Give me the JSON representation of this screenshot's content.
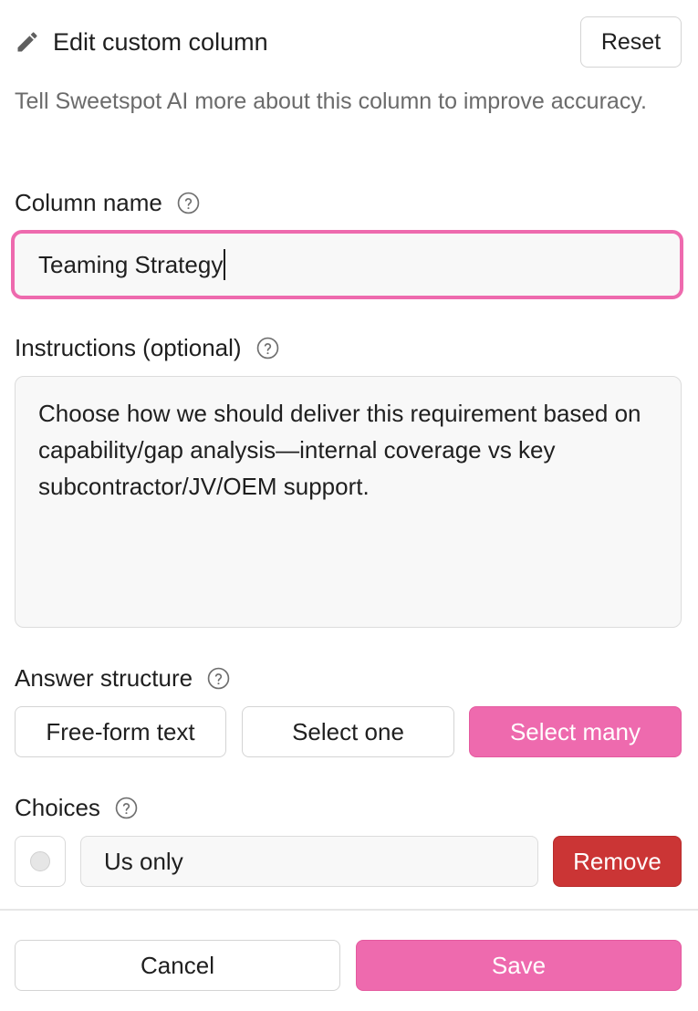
{
  "header": {
    "title": "Edit custom column",
    "reset_label": "Reset",
    "icon": "pencil-icon"
  },
  "subtitle": "Tell Sweetspot AI more about this column to improve accuracy.",
  "column_name": {
    "label": "Column name",
    "value": "Teaming Strategy"
  },
  "instructions": {
    "label": "Instructions (optional)",
    "value": "Choose how we should deliver this requirement based on capability/gap analysis—internal coverage vs key subcontractor/JV/OEM support."
  },
  "answer_structure": {
    "label": "Answer structure",
    "options": [
      "Free-form text",
      "Select one",
      "Select many"
    ],
    "selected": "Select many"
  },
  "choices": {
    "label": "Choices",
    "items": [
      {
        "value": "Us only",
        "remove_label": "Remove"
      }
    ]
  },
  "footer": {
    "cancel_label": "Cancel",
    "save_label": "Save"
  },
  "colors": {
    "accent": "#ee6aae",
    "danger": "#cb3535",
    "muted_text": "#6b6b6b"
  }
}
